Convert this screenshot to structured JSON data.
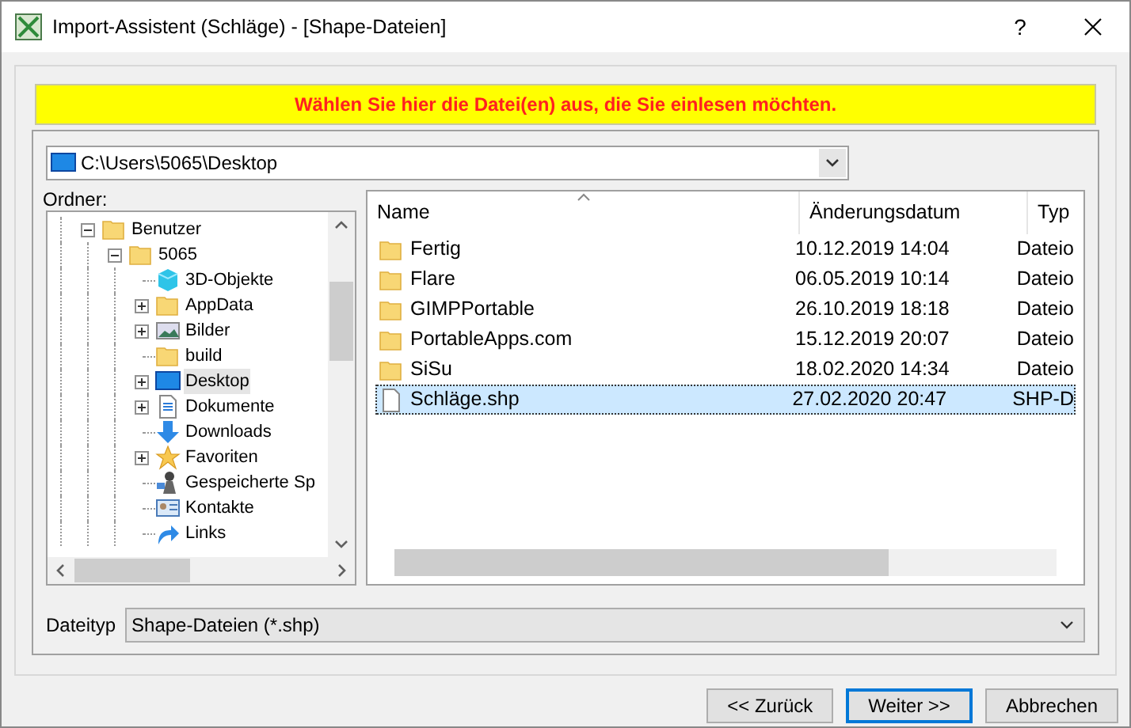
{
  "window": {
    "title": "Import-Assistent (Schläge) - [Shape-Dateien]",
    "help": "?"
  },
  "banner": "Wählen Sie hier die Datei(en) aus, die Sie einlesen möchten.",
  "path": {
    "value": "C:\\Users\\5065\\Desktop"
  },
  "tree": {
    "label": "Ordner:",
    "items": [
      {
        "label": "Benutzer",
        "kind": "folder",
        "expandable": true,
        "expanded": true,
        "selected": false,
        "children": [
          {
            "label": "5065",
            "kind": "folder",
            "expandable": true,
            "expanded": true,
            "selected": false,
            "children": [
              {
                "label": "3D-Objekte",
                "kind": "cube",
                "expandable": false,
                "selected": false
              },
              {
                "label": "AppData",
                "kind": "folder",
                "expandable": true,
                "expanded": false,
                "selected": false
              },
              {
                "label": "Bilder",
                "kind": "pictures",
                "expandable": true,
                "expanded": false,
                "selected": false
              },
              {
                "label": "build",
                "kind": "folder",
                "expandable": false,
                "selected": false
              },
              {
                "label": "Desktop",
                "kind": "desktop",
                "expandable": true,
                "expanded": false,
                "selected": true
              },
              {
                "label": "Dokumente",
                "kind": "documents",
                "expandable": true,
                "expanded": false,
                "selected": false
              },
              {
                "label": "Downloads",
                "kind": "downloads",
                "expandable": false,
                "selected": false
              },
              {
                "label": "Favoriten",
                "kind": "star",
                "expandable": true,
                "expanded": false,
                "selected": false
              },
              {
                "label": "Gespeicherte Sp",
                "kind": "games",
                "expandable": false,
                "selected": false
              },
              {
                "label": "Kontakte",
                "kind": "contacts",
                "expandable": false,
                "selected": false
              },
              {
                "label": "Links",
                "kind": "links",
                "expandable": false,
                "selected": false
              }
            ]
          }
        ]
      }
    ]
  },
  "files": {
    "columns": [
      "Name",
      "Änderungsdatum",
      "Typ"
    ],
    "rows": [
      {
        "name": "Fertig",
        "date": "10.12.2019 14:04",
        "type": "Dateio",
        "kind": "folder",
        "selected": false
      },
      {
        "name": "Flare",
        "date": "06.05.2019 10:14",
        "type": "Dateio",
        "kind": "folder",
        "selected": false
      },
      {
        "name": "GIMPPortable",
        "date": "26.10.2019 18:18",
        "type": "Dateio",
        "kind": "folder",
        "selected": false
      },
      {
        "name": "PortableApps.com",
        "date": "15.12.2019 20:07",
        "type": "Dateio",
        "kind": "folder",
        "selected": false
      },
      {
        "name": "SiSu",
        "date": "18.02.2020 14:34",
        "type": "Dateio",
        "kind": "folder",
        "selected": false
      },
      {
        "name": "Schläge.shp",
        "date": "27.02.2020 20:47",
        "type": "SHP-D",
        "kind": "file",
        "selected": true
      }
    ]
  },
  "filetype": {
    "label": "Dateityp",
    "value": "Shape-Dateien (*.shp)"
  },
  "buttons": [
    {
      "label": "<<  Zurück",
      "default": false
    },
    {
      "label": "Weiter  >>",
      "default": true
    },
    {
      "label": "Abbrechen",
      "default": false
    }
  ]
}
